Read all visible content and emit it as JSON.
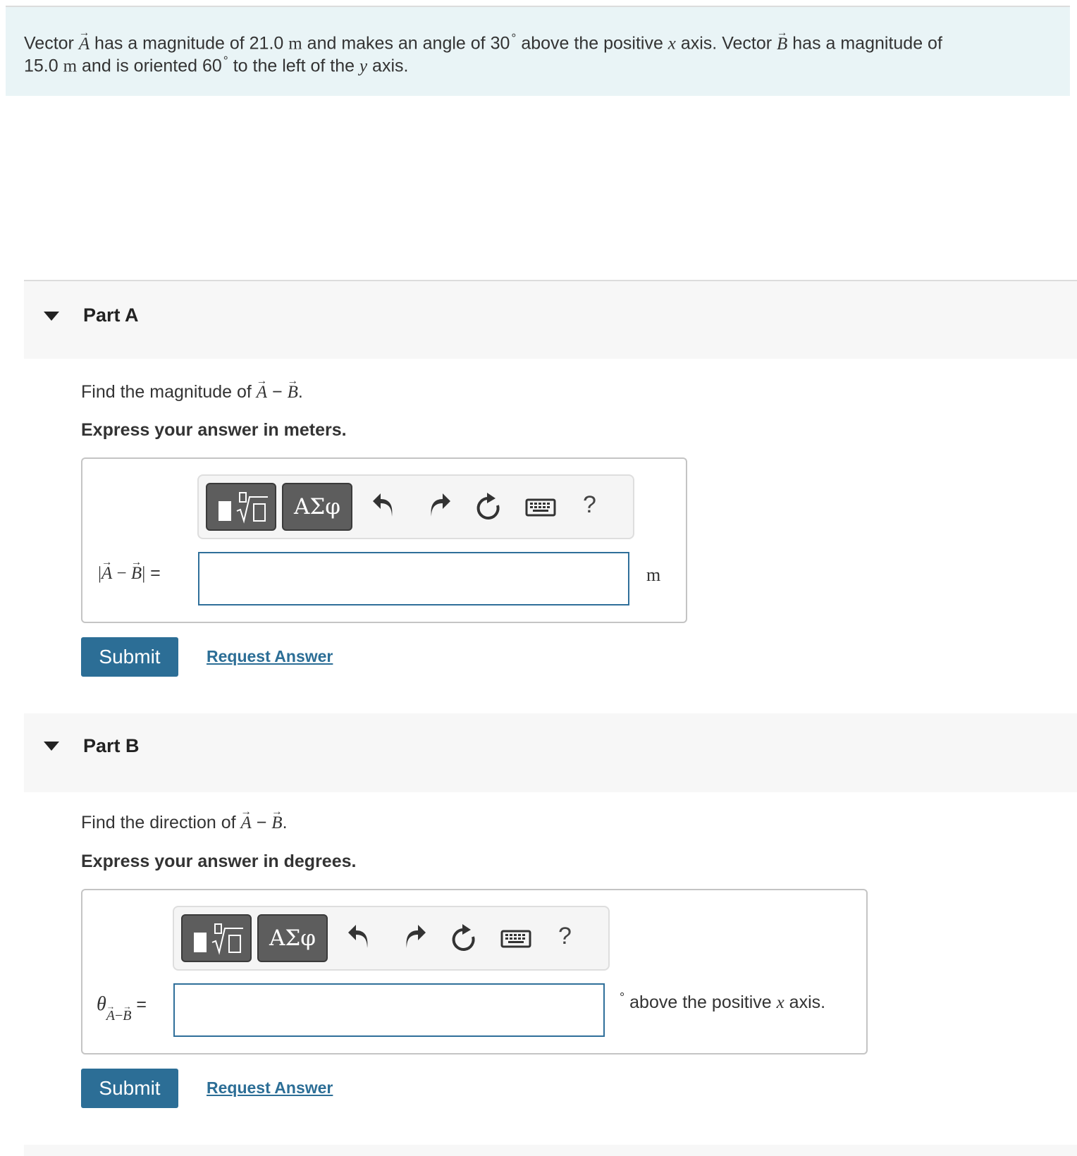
{
  "problem": {
    "vector_word_1": "Vector ",
    "vec_a": "A",
    "text_a": " has a magnitude of 21.0 ",
    "unit_m_1": "m",
    "text_b": " and makes an angle of 30",
    "deg_1": "°",
    "text_c": " above the positive ",
    "x_var": "x",
    "text_d": " axis. Vector ",
    "vec_b": "B",
    "text_e": " has a magnitude of",
    "text_f": "15.0 ",
    "unit_m_2": "m",
    "text_g": " and is oriented 60",
    "deg_2": "°",
    "text_h": " to the left of the ",
    "y_var": "y",
    "text_i": " axis."
  },
  "arrow": "→",
  "toolbar": {
    "greek_label": "ΑΣφ",
    "help_label": "?",
    "icons": [
      "templates-icon",
      "greek-symbols-icon",
      "undo-icon",
      "redo-icon",
      "reset-icon",
      "keyboard-icon",
      "help-icon"
    ]
  },
  "part_a": {
    "title": "Part A",
    "question_prefix": "Find the magnitude of ",
    "question_suffix": ".",
    "instruction": "Express your answer in meters.",
    "label_vec_a": "A",
    "label_minus": " − ",
    "label_vec_b": "B",
    "label_bar": "|",
    "label_eq": " =",
    "input_value": "",
    "units": "m",
    "submit": "Submit",
    "request": "Request Answer"
  },
  "part_b": {
    "title": "Part B",
    "question_prefix": "Find the direction of ",
    "question_suffix": ".",
    "instruction": "Express your answer in degrees.",
    "theta": "θ",
    "sub_vec_a": "A",
    "sub_minus": "−",
    "sub_vec_b": "B",
    "label_eq": " =",
    "input_value": "",
    "units_deg": "°",
    "units_text_1": " above the positive ",
    "units_x": "x",
    "units_text_2": " axis.",
    "submit": "Submit",
    "request": "Request Answer"
  },
  "colors": {
    "intro_bg": "#e9f4f6",
    "part_header_bg": "#f7f7f7",
    "submit_bg": "#2c6e96",
    "link": "#2c6e96",
    "input_border": "#2f6f9a",
    "template_btn": "#5d5d5d"
  }
}
